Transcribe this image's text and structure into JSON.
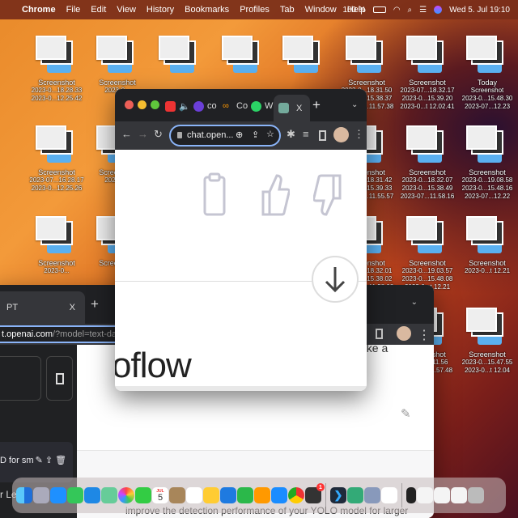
{
  "menubar": {
    "app": "Chrome",
    "items": [
      "File",
      "Edit",
      "View",
      "History",
      "Bookmarks",
      "Profiles",
      "Tab",
      "Window",
      "Help"
    ],
    "battery": "100 %",
    "datetime": "Wed 5. Jul 19:10"
  },
  "desktop": {
    "rows": [
      [
        {
          "lines": [
            "Screenshot",
            "2023-0...18.28.33",
            "2023-0...12.25.42"
          ]
        },
        {
          "lines": [
            "Screenshot",
            "2023-0..."
          ]
        },
        {
          "lines": []
        },
        {
          "lines": []
        },
        {
          "lines": []
        },
        {
          "lines": [
            "Screenshot",
            "2023-0...18.31.50",
            "2023-0...15.38.37",
            "2023-07...11.57.38"
          ]
        },
        {
          "lines": [
            "Screenshot",
            "2023-07...18.32.17",
            "2023-0...15.39.20",
            "2023-0...t 12.02.41"
          ]
        },
        {
          "lines": [
            "Today",
            "Screenshot",
            "2023-0...15.48.30",
            "2023-07...12.23"
          ]
        }
      ],
      [
        {
          "lines": [
            "Screenshot",
            "2023-07...16.28.17",
            "2023-0...12.25.26"
          ]
        },
        {
          "lines": [
            "Screenshot",
            "2023-0..."
          ]
        },
        null,
        null,
        null,
        {
          "lines": [
            "Screenshot",
            "2023-0...18.31.42",
            "2023-0...15.39.33",
            "2023-07...11.55.57"
          ]
        },
        {
          "lines": [
            "Screenshot",
            "2023-0...18.32.07",
            "2023-0...15.38.49",
            "2023-07...11.58.16"
          ]
        },
        {
          "lines": [
            "Screenshot",
            "2023-0...19.08.58",
            "2023-0...15.48.16",
            "2023-07...12.22"
          ]
        }
      ],
      [
        {
          "lines": [
            "Screenshot",
            "2023-0..."
          ]
        },
        {
          "lines": [
            "Screenshot"
          ]
        },
        null,
        null,
        null,
        {
          "lines": [
            "Screenshot",
            "2023-0...18.32.01",
            "2023-0...15.38.02",
            "2023-0...t 11.58.08"
          ]
        },
        {
          "lines": [
            "Screenshot",
            "2023-0...19.03.57",
            "2023-0...15.48.08",
            "2023-0...t 12.21"
          ]
        },
        {
          "lines": [
            "Screenshot",
            "2023-0...t 12.21"
          ]
        }
      ],
      [
        null,
        null,
        null,
        null,
        null,
        null,
        {
          "lines": [
            "Screenshot",
            "2023-0...11.56",
            "2023-0...11.57.48"
          ]
        },
        {
          "lines": [
            "Screenshot",
            "2023-0...15.47.55",
            "2023-0...t 12.04"
          ]
        }
      ]
    ]
  },
  "back_window": {
    "tab_title": "PT",
    "tab_close": "X",
    "new_tab": "+",
    "url_host": "t.openai.com",
    "url_path": "/?model=text-davinci",
    "sidebar_item": "D for sm",
    "sidebar_item2": "r Le",
    "main_text_top": "ake a",
    "main_text_bottom": "improve the detection performance of your YOLO model for larger"
  },
  "front_window": {
    "tabs": [
      "co",
      "Co",
      "Wh",
      "X"
    ],
    "new_tab": "+",
    "url": "chat.open...",
    "partial_text": "oflow"
  },
  "dock": {
    "apps": [
      "Finder",
      "Launchpad",
      "Safari",
      "Messages",
      "Mail",
      "Maps",
      "Photos",
      "FaceTime",
      "Calendar",
      "Contacts",
      "Reminders",
      "Notes",
      "Keynote",
      "Numbers",
      "Pages",
      "App Store",
      "Chrome",
      "ChatGPT",
      "Visual Studio Code",
      "App",
      "Preview",
      "App"
    ],
    "calendar_month": "JUL",
    "calendar_day": "5",
    "chatgpt_badge": "1"
  }
}
